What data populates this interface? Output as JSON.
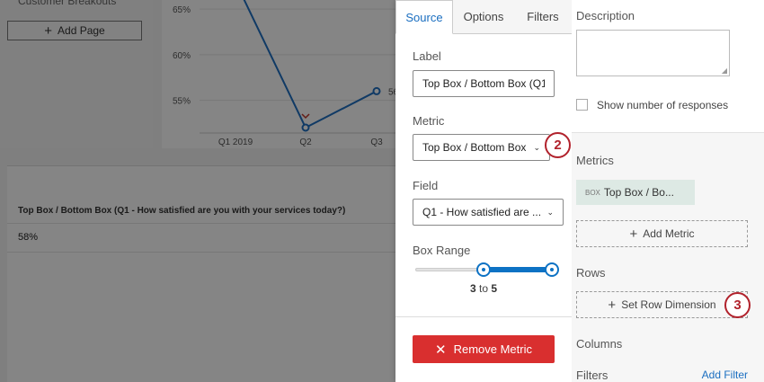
{
  "left_panel": {
    "cut_text": "Customer Breakouts",
    "add_page_label": "Add Page"
  },
  "chart_data": {
    "type": "line",
    "categories": [
      "Q1 2019",
      "Q2",
      "Q3"
    ],
    "values": [
      68,
      52,
      56
    ],
    "ylim": [
      52,
      66
    ],
    "yticks": [
      "65%",
      "60%",
      "55%"
    ],
    "ytick_values": [
      65,
      60,
      55
    ],
    "point_label": "56",
    "line_color": "#1f6fc1"
  },
  "table": {
    "header": "Top Box / Bottom Box (Q1 - How satisfied are you with your services today?)",
    "value": "58%"
  },
  "popover": {
    "tabs": [
      {
        "label": "Source",
        "active": true
      },
      {
        "label": "Options",
        "active": false
      },
      {
        "label": "Filters",
        "active": false
      }
    ],
    "label_title": "Label",
    "label_value": "Top Box / Bottom Box (Q1 - How satisfied are you with your services today?)",
    "metric_title": "Metric",
    "metric_value": "Top Box / Bottom Box",
    "field_title": "Field",
    "field_value": "Q1 - How satisfied are ...",
    "box_range_title": "Box Range",
    "box_range": {
      "min": 1,
      "max": 5,
      "from": 3,
      "to": 5,
      "from_label": "3",
      "connector": "to",
      "to_label": "5"
    },
    "remove_metric_label": "Remove Metric",
    "accent_color": "#0d72c4",
    "danger_color": "#d92f2f"
  },
  "right_panel": {
    "description_title": "Description",
    "show_responses_label": "Show number of responses",
    "metrics_title": "Metrics",
    "metric_chip_tag": "BOX",
    "metric_chip_label": "Top Box / Bo...",
    "add_metric_label": "Add Metric",
    "rows_title": "Rows",
    "set_row_dimension_label": "Set Row Dimension",
    "columns_title": "Columns",
    "filters_title": "Filters",
    "add_filter_label": "Add Filter"
  },
  "callouts": {
    "first": "2",
    "second": "3"
  },
  "callout_color": "#b1222c"
}
